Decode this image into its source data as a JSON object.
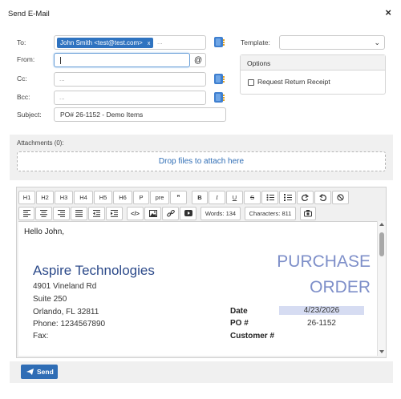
{
  "dialog": {
    "title": "Send E-Mail",
    "close": "×"
  },
  "form": {
    "to_label": "To:",
    "to_chip": "John Smith <test@test.com>",
    "to_chip_remove": "x",
    "to_more": "...",
    "from_label": "From:",
    "from_at": "@",
    "cc_label": "Cc:",
    "cc_placeholder": "...",
    "bcc_label": "Bcc:",
    "bcc_placeholder": "...",
    "subject_label": "Subject:",
    "subject_value": "PO# 26-1152 - Demo Items",
    "template_label": "Template:",
    "template_value": "",
    "options_title": "Options",
    "option_return_receipt": "Request Return Receipt"
  },
  "attachments": {
    "label": "Attachments (0):",
    "dropzone": "Drop files to attach here"
  },
  "toolbar": {
    "h1": "H1",
    "h2": "H2",
    "h3": "H3",
    "h4": "H4",
    "h5": "H5",
    "h6": "H6",
    "p": "P",
    "pre": "pre",
    "quote": "❞",
    "bold": "B",
    "italic": "I",
    "underline": "U",
    "strike": "S",
    "code": "</>",
    "words": "Words: 134",
    "characters": "Characters: 811"
  },
  "editor": {
    "greeting": "Hello John,",
    "company": "Aspire Technologies",
    "address": [
      "4901 Vineland Rd",
      "Suite 250",
      "Orlando, FL 32811",
      "Phone: 1234567890",
      "Fax:"
    ],
    "doc_title_1": "PURCHASE",
    "doc_title_2": "ORDER",
    "date_label": "Date",
    "date_value": "4/23/2026",
    "po_label": "PO #",
    "po_value": "26-1152",
    "customer_label": "Customer #",
    "customer_value": ""
  },
  "footer": {
    "send": "Send"
  },
  "colors": {
    "accent": "#2f6db5",
    "chip": "#2f73c0",
    "heading": "#2c4a8a",
    "title": "#7e8fc9",
    "date_highlight": "#d6dcf2"
  }
}
